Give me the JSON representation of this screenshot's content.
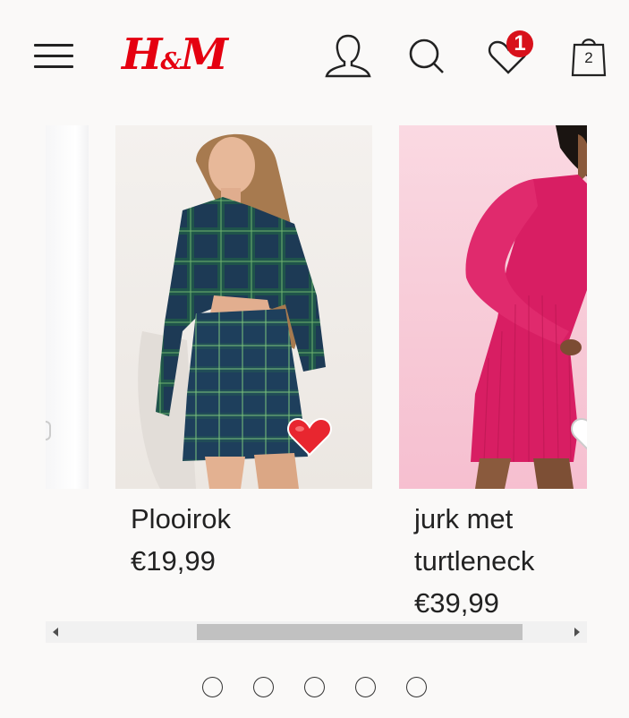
{
  "header": {
    "logo": "H&M",
    "logo_parts": [
      "H",
      "&",
      "M"
    ],
    "favorites_count": "1",
    "cart_count": "2",
    "colors": {
      "brand": "#e50010",
      "badge": "#d8111b"
    }
  },
  "carousel": {
    "products": [
      {
        "name": "Plooirok",
        "price": "€19,99",
        "favorited": true
      },
      {
        "name": "jurk met turtleneck",
        "name_lines": [
          "jurk met",
          "turtleneck"
        ],
        "price": "€39,99",
        "favorited": false
      }
    ],
    "scroll_position": 0.37,
    "page_count": 5
  }
}
